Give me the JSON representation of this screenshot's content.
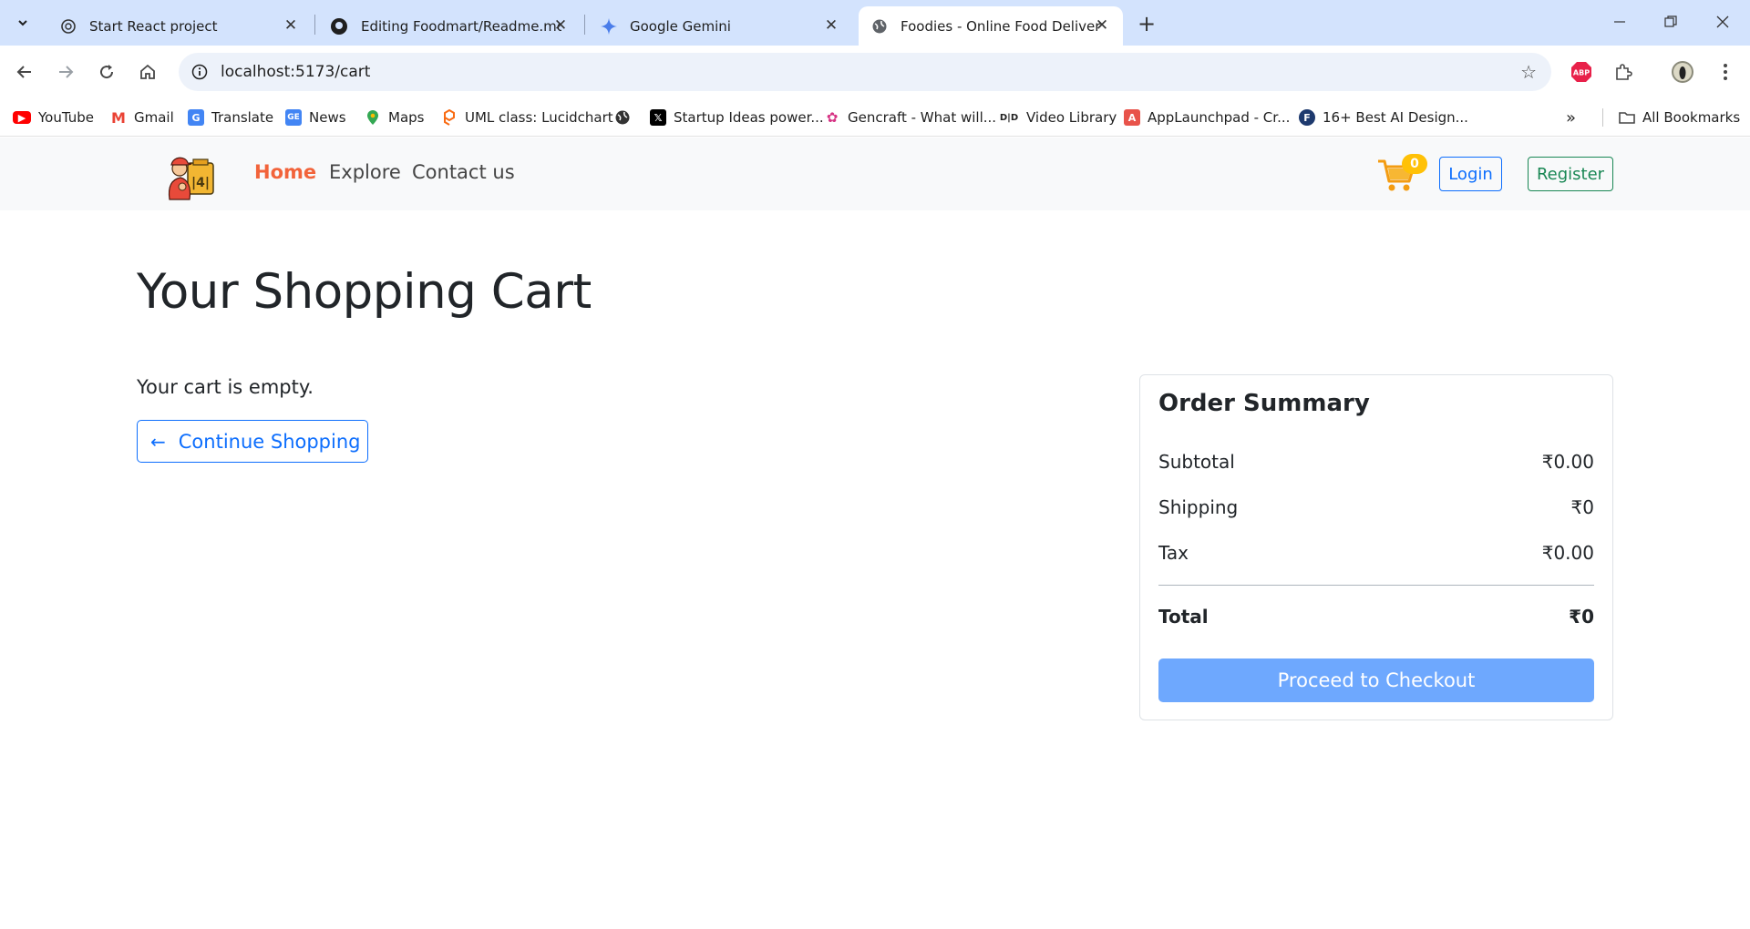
{
  "browser": {
    "tabs": [
      {
        "title": "Start React project",
        "icon": "openai-icon"
      },
      {
        "title": "Editing Foodmart/Readme.md at",
        "icon": "github-icon"
      },
      {
        "title": "Google Gemini",
        "icon": "gemini-icon"
      },
      {
        "title": "Foodies - Online Food Delivery",
        "icon": "globe-icon",
        "active": true
      }
    ],
    "url": "localhost:5173/cart",
    "bookmarks": [
      {
        "label": "YouTube",
        "icon": "youtube-icon",
        "color": "#ff0000"
      },
      {
        "label": "Gmail",
        "icon": "gmail-icon",
        "color": "#ea4335"
      },
      {
        "label": "Translate",
        "icon": "translate-icon",
        "color": "#4285f4"
      },
      {
        "label": "News",
        "icon": "news-icon",
        "color": "#4285f4"
      },
      {
        "label": "Maps",
        "icon": "maps-icon",
        "color": "#34a853"
      },
      {
        "label": "UML class: Lucidchart",
        "icon": "lucidchart-icon",
        "color": "#f96b13"
      },
      {
        "label": "",
        "icon": "globe-icon",
        "color": "#333333"
      },
      {
        "label": "Startup Ideas power...",
        "icon": "x-icon",
        "color": "#000000"
      },
      {
        "label": "Gencraft - What will...",
        "icon": "gencraft-icon",
        "color": "#d63384"
      },
      {
        "label": "Video Library",
        "icon": "video-library-icon",
        "color": "#222222"
      },
      {
        "label": "AppLaunchpad - Cr...",
        "icon": "applaunchpad-icon",
        "color": "#e8534a"
      },
      {
        "label": "16+ Best AI Design...",
        "icon": "f-icon",
        "color": "#1e3a6e"
      }
    ],
    "all_bookmarks": "All Bookmarks"
  },
  "app": {
    "nav": {
      "home": "Home",
      "explore": "Explore",
      "contact": "Contact us",
      "cart_count": "0",
      "login": "Login",
      "register": "Register"
    },
    "cart": {
      "title": "Your Shopping Cart",
      "empty_message": "Your cart is empty.",
      "continue_label": "Continue Shopping",
      "continue_icon": "arrow-left-icon"
    },
    "summary": {
      "title": "Order Summary",
      "subtotal_label": "Subtotal",
      "subtotal_value": "₹0.00",
      "shipping_label": "Shipping",
      "shipping_value": "₹0",
      "tax_label": "Tax",
      "tax_value": "₹0.00",
      "total_label": "Total",
      "total_value": "₹0",
      "checkout_label": "Proceed to Checkout"
    }
  },
  "colors": {
    "accent": "#f2633a",
    "primary": "#0d6efd",
    "success": "#198754",
    "checkout": "#6ea8fe",
    "badge": "#ffc107"
  }
}
